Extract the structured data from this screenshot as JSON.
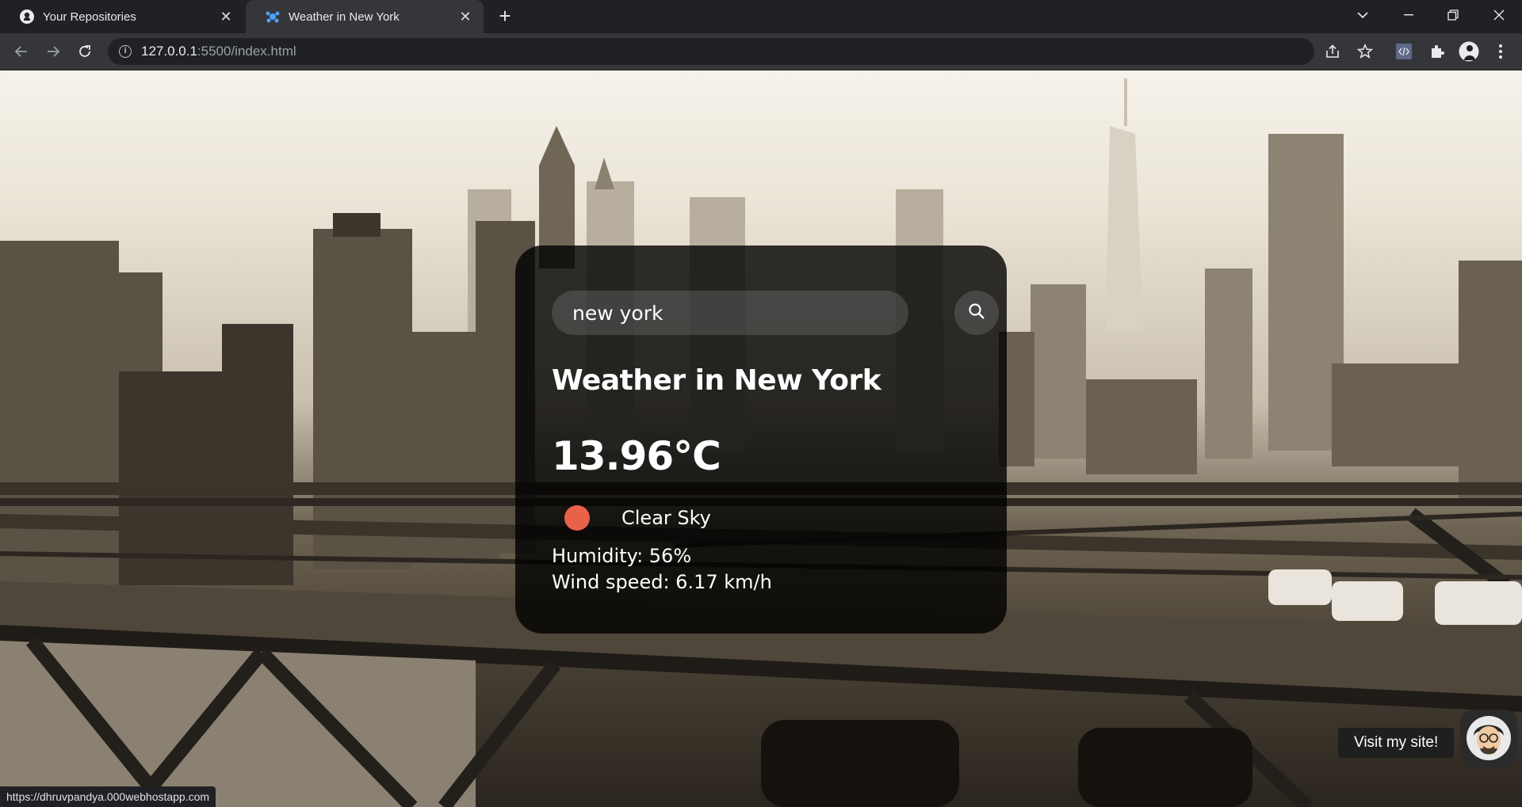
{
  "browser": {
    "tabs": [
      {
        "title": "Your Repositories",
        "icon": "github-icon",
        "active": false
      },
      {
        "title": "Weather in New York",
        "icon": "weather-favicon-icon",
        "active": true
      }
    ],
    "address": {
      "host": "127.0.0.1",
      "rest": ":5500/index.html"
    }
  },
  "weather": {
    "search_value": "new york",
    "city_heading": "Weather in New York",
    "temperature": "13.96°C",
    "description": "Clear Sky",
    "humidity": "Humidity: 56%",
    "wind": "Wind speed: 6.17 km/h",
    "icon_color": "#e8624a"
  },
  "status_url": "https://dhruvpandya.000webhostapp.com",
  "visit_site": {
    "label": "Visit my site!"
  }
}
